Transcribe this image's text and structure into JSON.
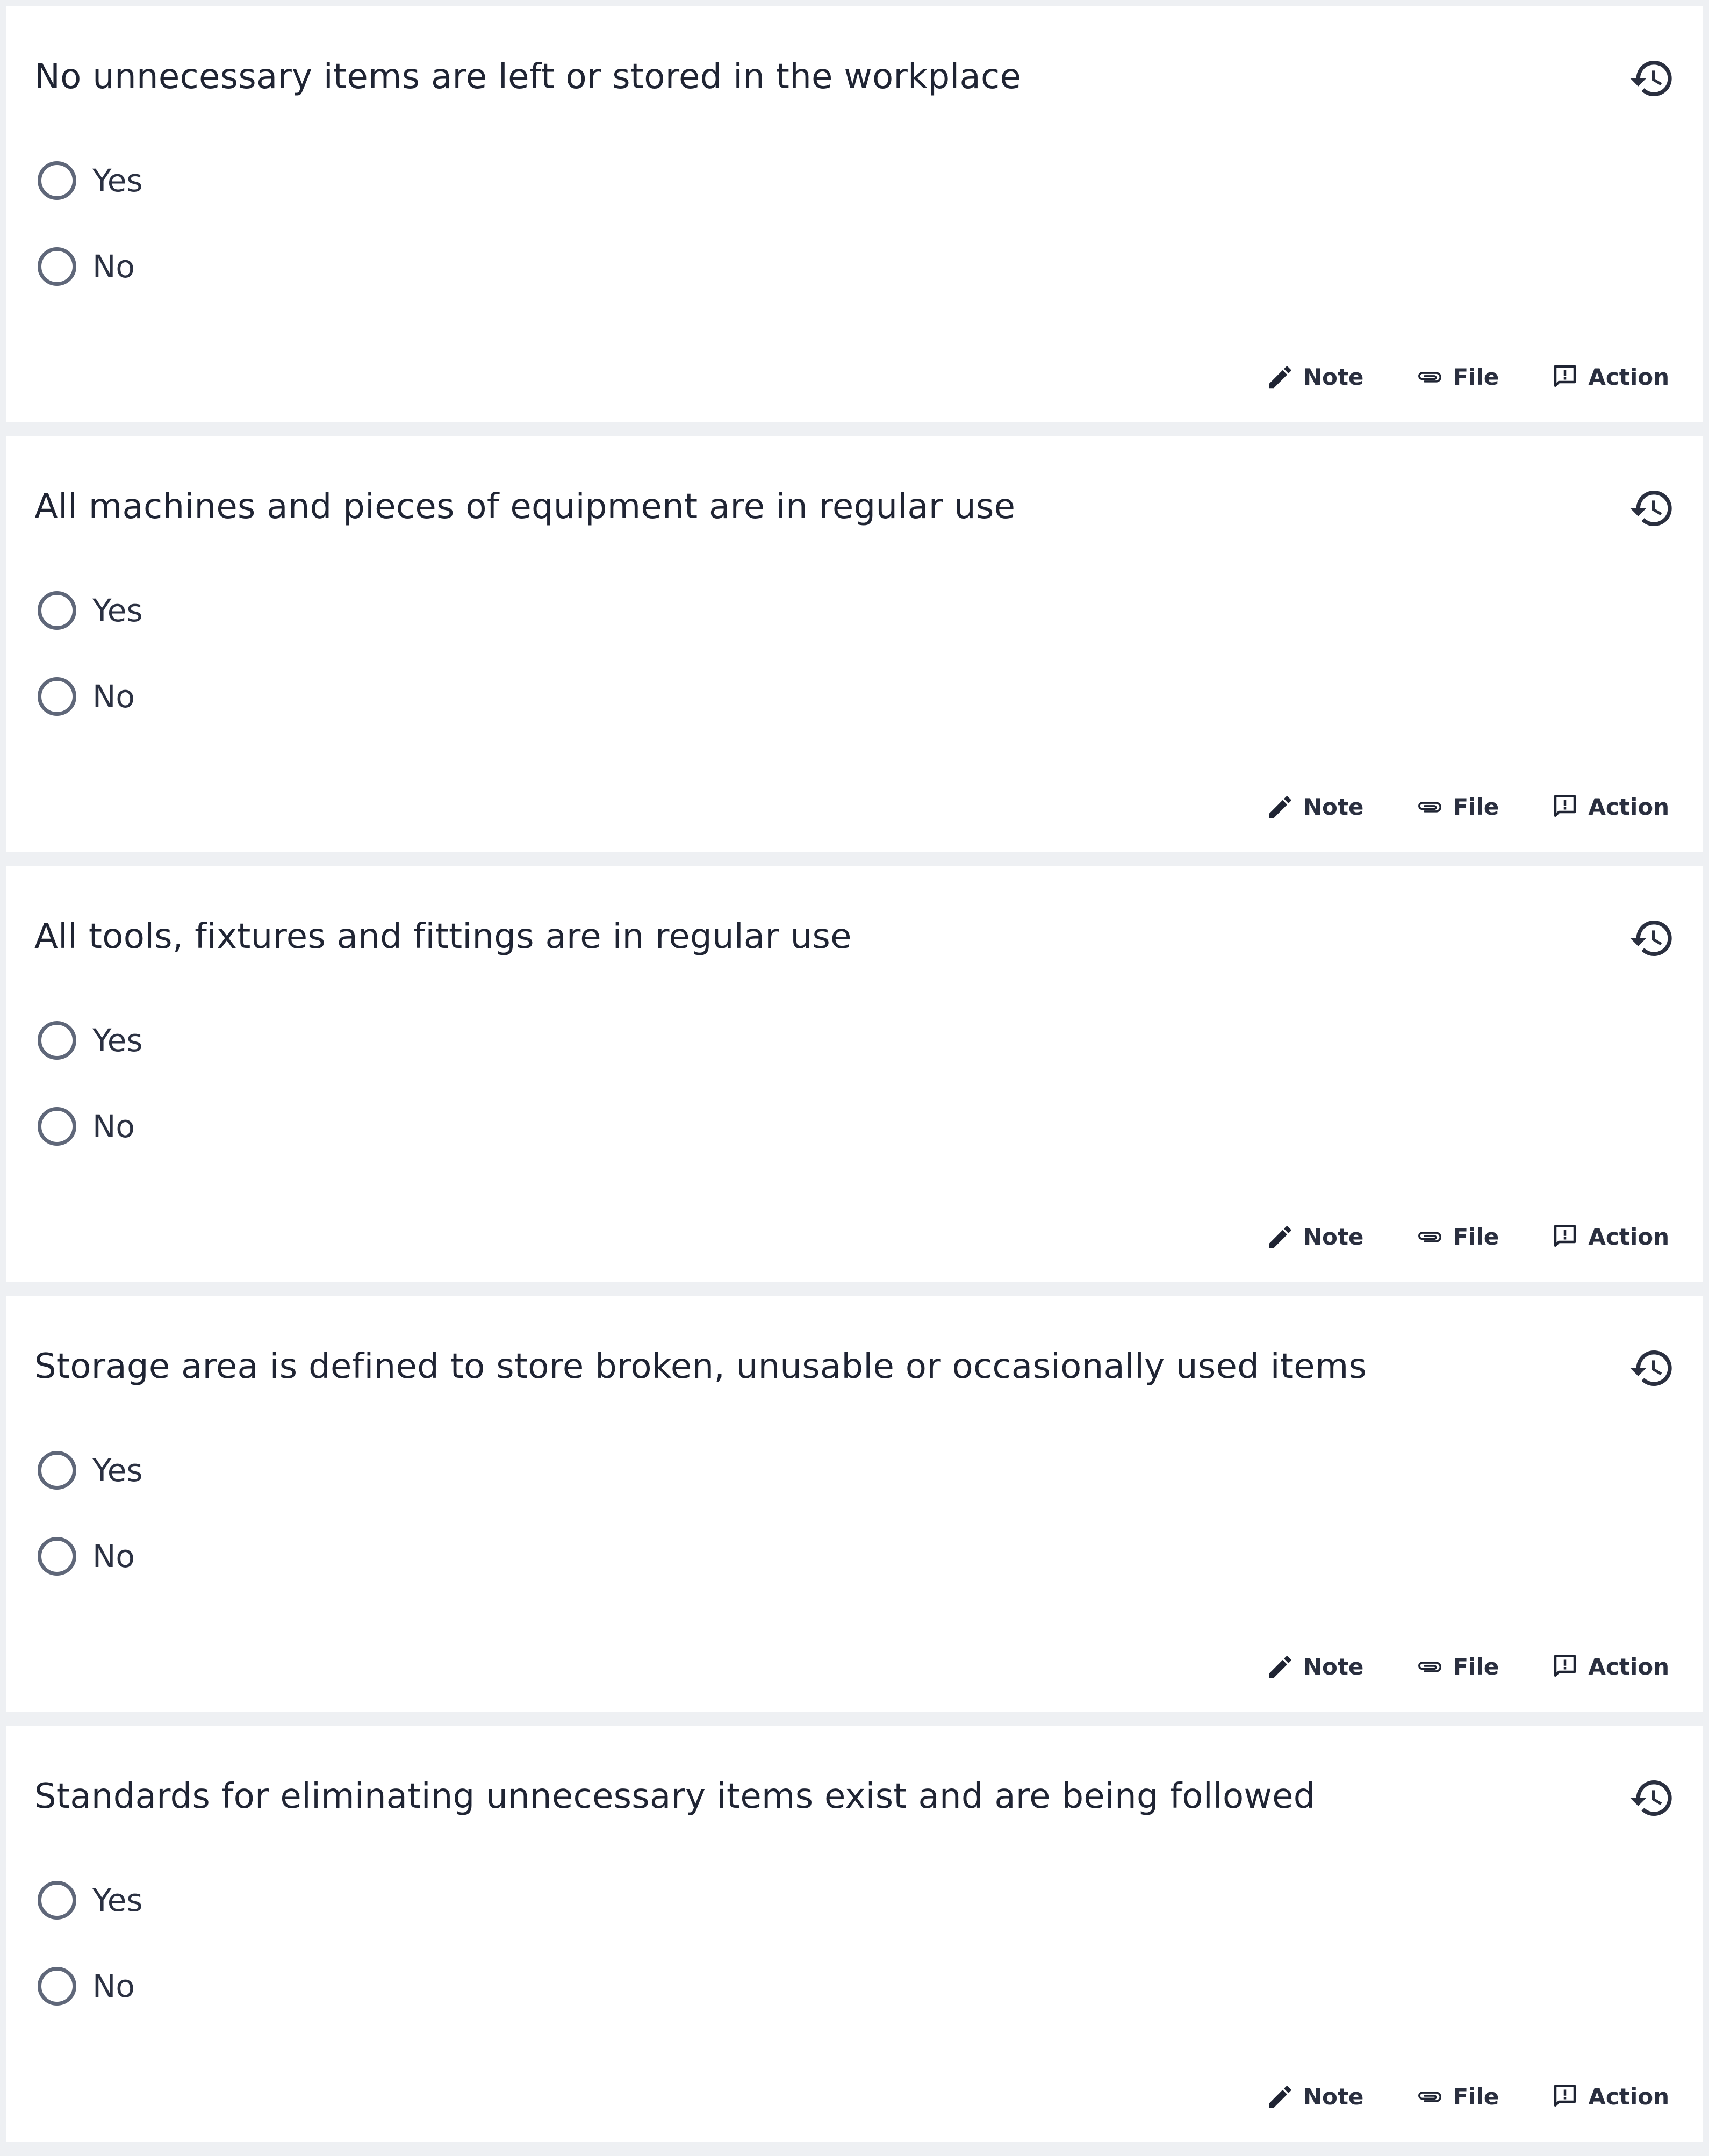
{
  "questions": [
    {
      "title": "No unnecessary items are left or stored in the workplace",
      "options": [
        "Yes",
        "No"
      ],
      "actions": {
        "note": "Note",
        "file": "File",
        "action": "Action"
      },
      "history_icon": "history-icon"
    },
    {
      "title": "All machines and pieces of equipment are in regular use",
      "options": [
        "Yes",
        "No"
      ],
      "actions": {
        "note": "Note",
        "file": "File",
        "action": "Action"
      },
      "history_icon": "history-icon"
    },
    {
      "title": "All tools, fixtures and fittings are in regular use",
      "options": [
        "Yes",
        "No"
      ],
      "actions": {
        "note": "Note",
        "file": "File",
        "action": "Action"
      },
      "history_icon": "history-icon"
    },
    {
      "title": "Storage area is defined to store broken, unusable or occasionally used items",
      "options": [
        "Yes",
        "No"
      ],
      "actions": {
        "note": "Note",
        "file": "File",
        "action": "Action"
      },
      "history_icon": "history-icon"
    },
    {
      "title": "Standards for eliminating unnecessary items exist and are being followed",
      "options": [
        "Yes",
        "No"
      ],
      "actions": {
        "note": "Note",
        "file": "File",
        "action": "Action"
      },
      "history_icon": "history-icon"
    }
  ],
  "icons": {
    "note": "pencil-icon",
    "file": "paperclip-icon",
    "action": "comment-alert-icon",
    "history": "history-icon"
  },
  "colors": {
    "background": "#eef0f3",
    "card": "#ffffff",
    "text": "#1f2433",
    "radio_border": "#5f6779"
  }
}
